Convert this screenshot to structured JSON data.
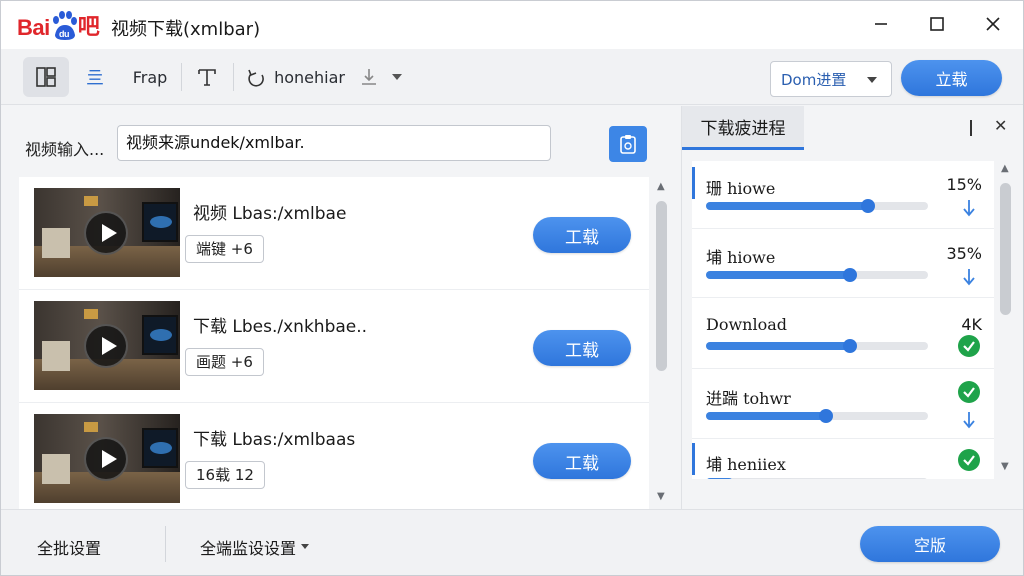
{
  "titlebar": {
    "logo_left": "Bai",
    "logo_mid": "du",
    "logo_right": "吧",
    "title": "视频下载(xmlbar)"
  },
  "toolbar": {
    "btn2": "亖",
    "btn3": "Frap",
    "btn4_label": "honehiar",
    "dom_select": "Dom进置",
    "download_btn": "立载"
  },
  "left": {
    "url_label": "视频输入...",
    "url_value": "视频来源undek/xmlbar.",
    "videos": [
      {
        "title": "视频 Lbas:/xmlbae",
        "tag": "端键 +6",
        "button": "工载"
      },
      {
        "title": "下载 Lbes./xnkhbae..",
        "tag": "画题 +6",
        "button": "工载"
      },
      {
        "title": "下载 Lbas:/xmlbaas",
        "tag": "16载 12",
        "button": "工载"
      }
    ]
  },
  "right": {
    "tab": "下载疲进程",
    "items": [
      {
        "name": "珊 hiowe",
        "pct": "15%",
        "progress": 0.73,
        "status": "arrow-down-icon"
      },
      {
        "name": "埔 hiowe",
        "pct": "35%",
        "progress": 0.65,
        "status": "arrow-down-icon"
      },
      {
        "name": "Download",
        "pct": "4K",
        "progress": 0.65,
        "status": "check-circle-icon"
      },
      {
        "name": "逬踹 tohwr",
        "pct": "",
        "progress": 0.54,
        "status": "check-and-arrow"
      },
      {
        "name": "埔 heniiex",
        "pct": "",
        "progress": 0.12,
        "status": "check-circle-icon"
      }
    ]
  },
  "footer": {
    "settings": "全批设置",
    "settings2": "全端监设设置",
    "start_btn": "空版"
  },
  "colors": {
    "accent": "#2f76dc",
    "logo_red": "#e0262b",
    "success": "#1fa34a"
  }
}
